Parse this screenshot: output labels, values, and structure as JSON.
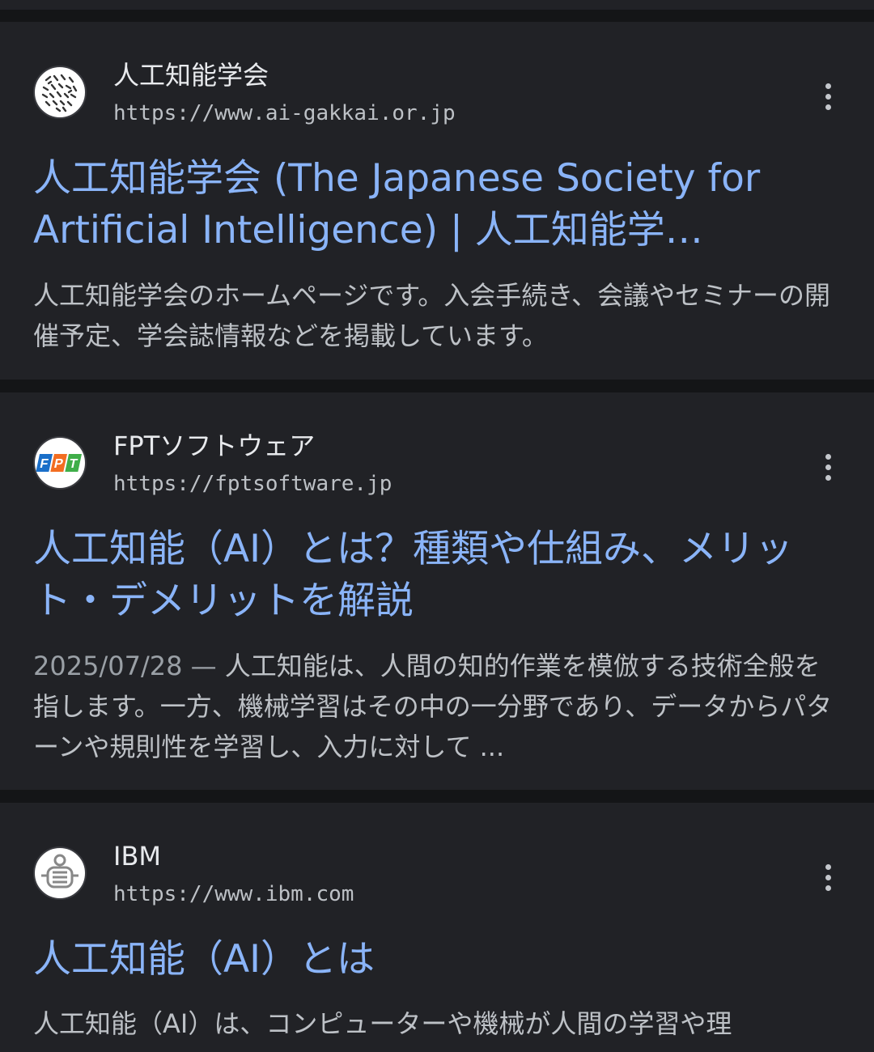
{
  "results": [
    {
      "site_name": "人工知能学会",
      "url": "https://www.ai-gakkai.or.jp",
      "favicon": "ai-gakkai-logo-icon",
      "title": "人工知能学会 (The Japanese Society for Artificial Intelligence) | 人工知能学…",
      "snippet": "人工知能学会のホームページです。入会手続き、会議やセミナーの開催予定、学会誌情報などを掲載しています。"
    },
    {
      "site_name": "FPTソフトウェア",
      "url": "https://fptsoftware.jp",
      "favicon": "fpt-logo-icon",
      "title": "人工知能（AI）とは？種類や仕組み、メリット・デメリットを解説",
      "date": "2025/07/28",
      "date_sep": " — ",
      "snippet": "人工知能は、人間の知的作業を模倣する技術全般を指します。一方、機械学習はその中の一分野であり、データからパターンや規則性を学習し、入力に対して ..."
    },
    {
      "site_name": "IBM",
      "url": "https://www.ibm.com",
      "favicon": "ibm-logo-icon",
      "title": "人工知能（AI）とは",
      "snippet": "人工知能（AI）は、コンピューターや機械が人間の学習や理"
    }
  ],
  "colors": {
    "background": "#141517",
    "card": "#212226",
    "title_link": "#8ab4f8",
    "text_primary": "#e8eaed",
    "text_secondary": "#bdc1c6"
  }
}
